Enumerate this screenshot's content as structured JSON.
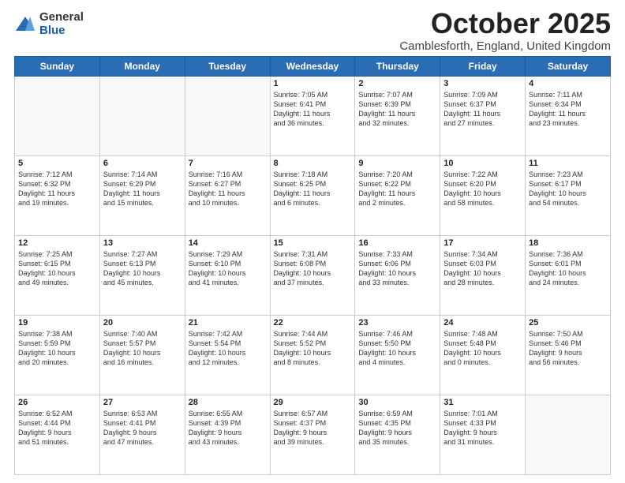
{
  "header": {
    "logo_general": "General",
    "logo_blue": "Blue",
    "month_title": "October 2025",
    "location": "Camblesforth, England, United Kingdom"
  },
  "weekdays": [
    "Sunday",
    "Monday",
    "Tuesday",
    "Wednesday",
    "Thursday",
    "Friday",
    "Saturday"
  ],
  "weeks": [
    [
      {
        "day": "",
        "info": ""
      },
      {
        "day": "",
        "info": ""
      },
      {
        "day": "",
        "info": ""
      },
      {
        "day": "1",
        "info": "Sunrise: 7:05 AM\nSunset: 6:41 PM\nDaylight: 11 hours\nand 36 minutes."
      },
      {
        "day": "2",
        "info": "Sunrise: 7:07 AM\nSunset: 6:39 PM\nDaylight: 11 hours\nand 32 minutes."
      },
      {
        "day": "3",
        "info": "Sunrise: 7:09 AM\nSunset: 6:37 PM\nDaylight: 11 hours\nand 27 minutes."
      },
      {
        "day": "4",
        "info": "Sunrise: 7:11 AM\nSunset: 6:34 PM\nDaylight: 11 hours\nand 23 minutes."
      }
    ],
    [
      {
        "day": "5",
        "info": "Sunrise: 7:12 AM\nSunset: 6:32 PM\nDaylight: 11 hours\nand 19 minutes."
      },
      {
        "day": "6",
        "info": "Sunrise: 7:14 AM\nSunset: 6:29 PM\nDaylight: 11 hours\nand 15 minutes."
      },
      {
        "day": "7",
        "info": "Sunrise: 7:16 AM\nSunset: 6:27 PM\nDaylight: 11 hours\nand 10 minutes."
      },
      {
        "day": "8",
        "info": "Sunrise: 7:18 AM\nSunset: 6:25 PM\nDaylight: 11 hours\nand 6 minutes."
      },
      {
        "day": "9",
        "info": "Sunrise: 7:20 AM\nSunset: 6:22 PM\nDaylight: 11 hours\nand 2 minutes."
      },
      {
        "day": "10",
        "info": "Sunrise: 7:22 AM\nSunset: 6:20 PM\nDaylight: 10 hours\nand 58 minutes."
      },
      {
        "day": "11",
        "info": "Sunrise: 7:23 AM\nSunset: 6:17 PM\nDaylight: 10 hours\nand 54 minutes."
      }
    ],
    [
      {
        "day": "12",
        "info": "Sunrise: 7:25 AM\nSunset: 6:15 PM\nDaylight: 10 hours\nand 49 minutes."
      },
      {
        "day": "13",
        "info": "Sunrise: 7:27 AM\nSunset: 6:13 PM\nDaylight: 10 hours\nand 45 minutes."
      },
      {
        "day": "14",
        "info": "Sunrise: 7:29 AM\nSunset: 6:10 PM\nDaylight: 10 hours\nand 41 minutes."
      },
      {
        "day": "15",
        "info": "Sunrise: 7:31 AM\nSunset: 6:08 PM\nDaylight: 10 hours\nand 37 minutes."
      },
      {
        "day": "16",
        "info": "Sunrise: 7:33 AM\nSunset: 6:06 PM\nDaylight: 10 hours\nand 33 minutes."
      },
      {
        "day": "17",
        "info": "Sunrise: 7:34 AM\nSunset: 6:03 PM\nDaylight: 10 hours\nand 28 minutes."
      },
      {
        "day": "18",
        "info": "Sunrise: 7:36 AM\nSunset: 6:01 PM\nDaylight: 10 hours\nand 24 minutes."
      }
    ],
    [
      {
        "day": "19",
        "info": "Sunrise: 7:38 AM\nSunset: 5:59 PM\nDaylight: 10 hours\nand 20 minutes."
      },
      {
        "day": "20",
        "info": "Sunrise: 7:40 AM\nSunset: 5:57 PM\nDaylight: 10 hours\nand 16 minutes."
      },
      {
        "day": "21",
        "info": "Sunrise: 7:42 AM\nSunset: 5:54 PM\nDaylight: 10 hours\nand 12 minutes."
      },
      {
        "day": "22",
        "info": "Sunrise: 7:44 AM\nSunset: 5:52 PM\nDaylight: 10 hours\nand 8 minutes."
      },
      {
        "day": "23",
        "info": "Sunrise: 7:46 AM\nSunset: 5:50 PM\nDaylight: 10 hours\nand 4 minutes."
      },
      {
        "day": "24",
        "info": "Sunrise: 7:48 AM\nSunset: 5:48 PM\nDaylight: 10 hours\nand 0 minutes."
      },
      {
        "day": "25",
        "info": "Sunrise: 7:50 AM\nSunset: 5:46 PM\nDaylight: 9 hours\nand 56 minutes."
      }
    ],
    [
      {
        "day": "26",
        "info": "Sunrise: 6:52 AM\nSunset: 4:44 PM\nDaylight: 9 hours\nand 51 minutes."
      },
      {
        "day": "27",
        "info": "Sunrise: 6:53 AM\nSunset: 4:41 PM\nDaylight: 9 hours\nand 47 minutes."
      },
      {
        "day": "28",
        "info": "Sunrise: 6:55 AM\nSunset: 4:39 PM\nDaylight: 9 hours\nand 43 minutes."
      },
      {
        "day": "29",
        "info": "Sunrise: 6:57 AM\nSunset: 4:37 PM\nDaylight: 9 hours\nand 39 minutes."
      },
      {
        "day": "30",
        "info": "Sunrise: 6:59 AM\nSunset: 4:35 PM\nDaylight: 9 hours\nand 35 minutes."
      },
      {
        "day": "31",
        "info": "Sunrise: 7:01 AM\nSunset: 4:33 PM\nDaylight: 9 hours\nand 31 minutes."
      },
      {
        "day": "",
        "info": ""
      }
    ]
  ]
}
